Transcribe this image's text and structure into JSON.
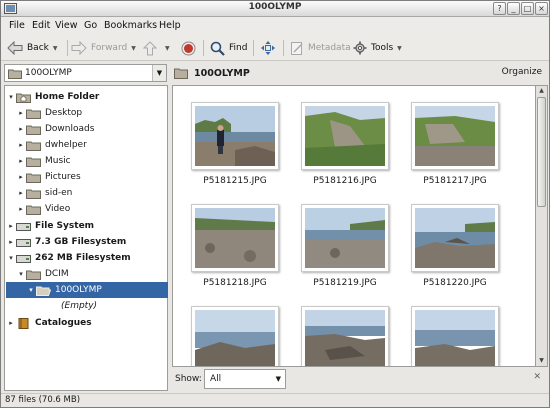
{
  "window": {
    "title": "100OLYMP",
    "controls": {
      "help": "?",
      "minimize": "_",
      "maximize": "□",
      "close": "×"
    }
  },
  "menubar": {
    "items": [
      {
        "label": "File",
        "mnemonic": "F"
      },
      {
        "label": "Edit",
        "mnemonic": "E"
      },
      {
        "label": "View",
        "mnemonic": "V"
      },
      {
        "label": "Go",
        "mnemonic": "G"
      },
      {
        "label": "Bookmarks",
        "mnemonic": "B"
      },
      {
        "label": "Help",
        "mnemonic": "H"
      }
    ]
  },
  "toolbar": {
    "back_label": "Back",
    "forward_label": "Forward",
    "find_label": "Find",
    "metadata_label": "Metadata",
    "tools_label": "Tools"
  },
  "left_pane": {
    "location_combo": "100OLYMP",
    "tree": [
      {
        "label": "Home Folder",
        "bold": true
      },
      {
        "label": "Desktop"
      },
      {
        "label": "Downloads"
      },
      {
        "label": "dwhelper"
      },
      {
        "label": "Music"
      },
      {
        "label": "Pictures"
      },
      {
        "label": "sid-en"
      },
      {
        "label": "Video"
      },
      {
        "label": "File System",
        "bold": true
      },
      {
        "label": "7.3 GB Filesystem",
        "bold": true
      },
      {
        "label": "262 MB Filesystem",
        "bold": true
      },
      {
        "label": "DCIM"
      },
      {
        "label": "100OLYMP",
        "selected": true
      },
      {
        "label": "(Empty)",
        "italic": true
      },
      {
        "label": "Catalogues",
        "bold": true
      }
    ]
  },
  "right_pane": {
    "folder_title": "100OLYMP",
    "organize_label": "Organize",
    "thumbnails": [
      {
        "name": "P5181215.JPG",
        "scene": "person"
      },
      {
        "name": "P5181216.JPG",
        "scene": "cliff"
      },
      {
        "name": "P5181217.JPG",
        "scene": "cliff2"
      },
      {
        "name": "P5181218.JPG",
        "scene": "stones"
      },
      {
        "name": "P5181219.JPG",
        "scene": "stones2"
      },
      {
        "name": "P5181220.JPG",
        "scene": "rocks"
      },
      {
        "name": "",
        "scene": "sea"
      },
      {
        "name": "",
        "scene": "sea2"
      },
      {
        "name": "",
        "scene": "sea3"
      }
    ],
    "show_label": "Show:",
    "show_value": "All"
  },
  "statusbar": {
    "text": "87 files (70.6 MB)"
  },
  "colors": {
    "selection": "#3465a4",
    "folder": "#b7b0a0",
    "record": "#c0392b"
  }
}
